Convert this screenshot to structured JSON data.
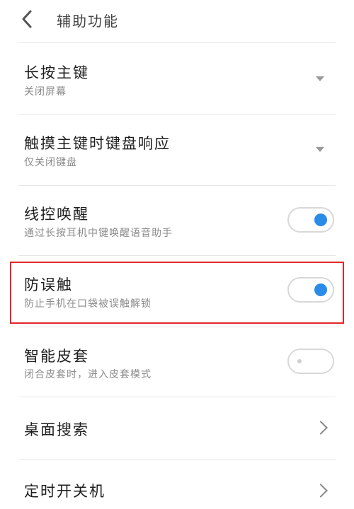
{
  "header": {
    "title": "辅助功能"
  },
  "items": [
    {
      "label": "长按主键",
      "sub": "关闭屏幕",
      "control": "dropdown"
    },
    {
      "label": "触摸主键时键盘响应",
      "sub": "仅关闭键盘",
      "control": "dropdown"
    },
    {
      "label": "线控唤醒",
      "sub": "通过长按耳机中键唤醒语音助手",
      "control": "toggle",
      "state": "on"
    },
    {
      "label": "防误触",
      "sub": "防止手机在口袋被误触解锁",
      "control": "toggle",
      "state": "on"
    },
    {
      "label": "智能皮套",
      "sub": "闭合皮套时，进入皮套模式",
      "control": "toggle",
      "state": "off"
    },
    {
      "label": "桌面搜索",
      "control": "link"
    },
    {
      "label": "定时开关机",
      "control": "link"
    }
  ],
  "colors": {
    "accent": "#2a8ce8",
    "highlight": "#e2262b"
  }
}
